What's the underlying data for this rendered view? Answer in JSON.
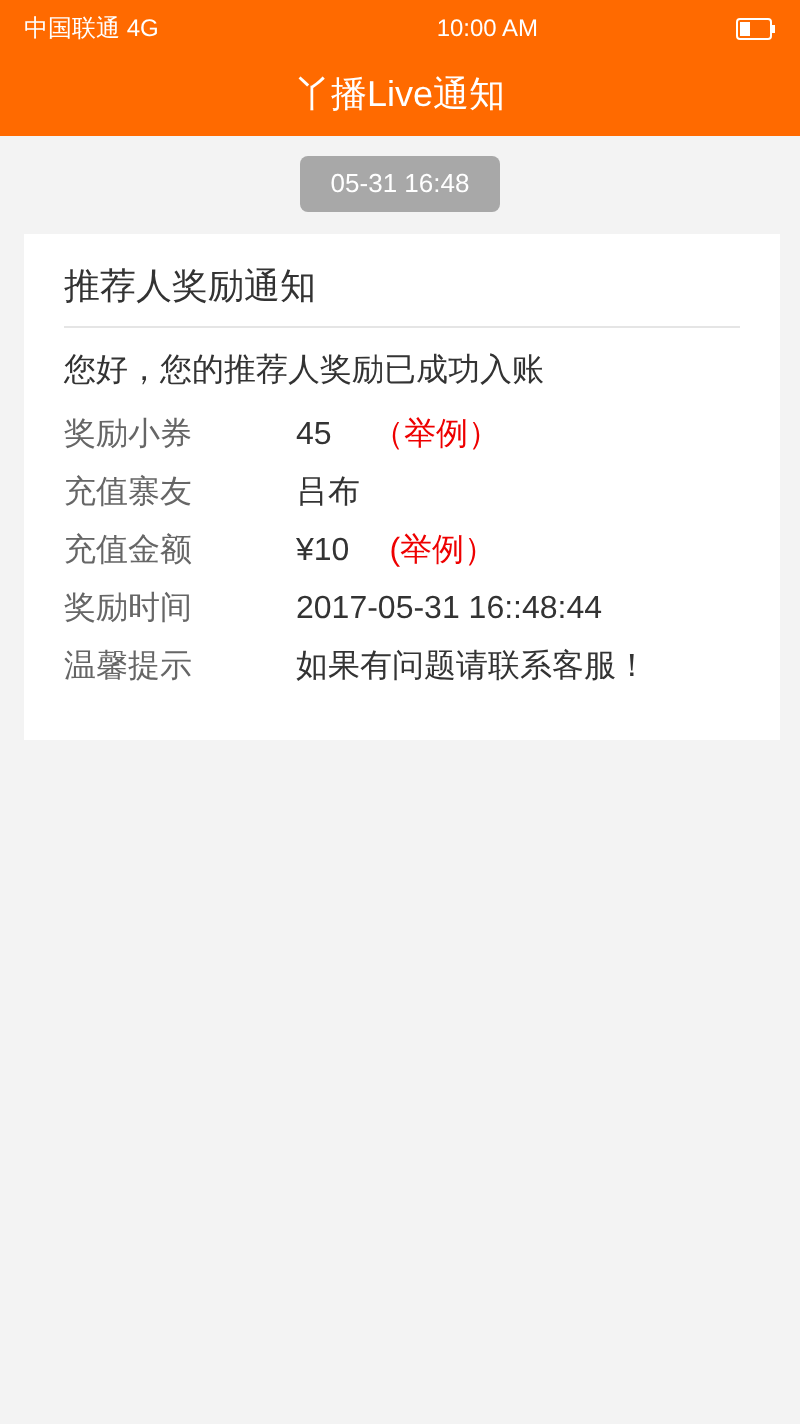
{
  "status_bar": {
    "carrier": "中国联通 4G",
    "time": "10:00 AM"
  },
  "header": {
    "title": "丫播Live通知"
  },
  "timestamp": "05-31 16:48",
  "card": {
    "title": "推荐人奖励通知",
    "greeting": "您好，您的推荐人奖励已成功入账",
    "rows": [
      {
        "label": "奖励小券",
        "value": "45",
        "note": "（举例）"
      },
      {
        "label": "充值寨友",
        "value": "吕布"
      },
      {
        "label": "充值金额",
        "value": "¥10",
        "note": "(举例）"
      },
      {
        "label": "奖励时间",
        "value": "2017-05-31 16::48:44"
      },
      {
        "label": "温馨提示",
        "value": "如果有问题请联系客服！"
      }
    ]
  }
}
